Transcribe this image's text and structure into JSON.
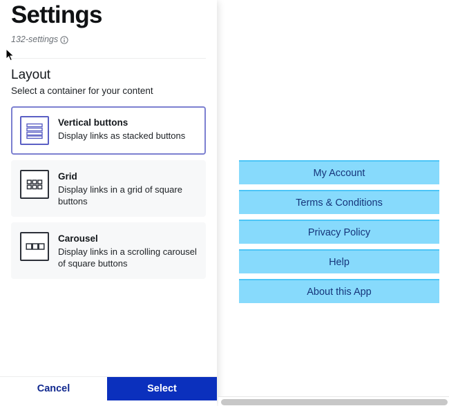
{
  "header": {
    "title": "Settings",
    "subtitle": "132-settings",
    "info_icon": "info-circle-icon"
  },
  "section": {
    "title": "Layout",
    "description": "Select a container for your content"
  },
  "options": [
    {
      "id": "vertical-buttons",
      "label": "Vertical buttons",
      "description": "Display links as stacked buttons",
      "icon": "stacked-bars-icon",
      "selected": true
    },
    {
      "id": "grid",
      "label": "Grid",
      "description": "Display links in a grid of square buttons",
      "icon": "grid-squares-icon",
      "selected": false
    },
    {
      "id": "carousel",
      "label": "Carousel",
      "description": "Display links in a scrolling carousel of square buttons",
      "icon": "carousel-squares-icon",
      "selected": false
    }
  ],
  "footer": {
    "cancel_label": "Cancel",
    "select_label": "Select"
  },
  "preview": {
    "buttons": [
      {
        "label": "My Account"
      },
      {
        "label": "Terms & Conditions"
      },
      {
        "label": "Privacy Policy"
      },
      {
        "label": "Help"
      },
      {
        "label": "About this App"
      }
    ]
  },
  "colors": {
    "selection_border": "#7b7fd0",
    "primary_button": "#0b30bd",
    "cancel_text": "#11298f",
    "preview_button_fill": "#87dafc",
    "preview_button_border": "#4cc5f7",
    "preview_button_text": "#16357a"
  }
}
